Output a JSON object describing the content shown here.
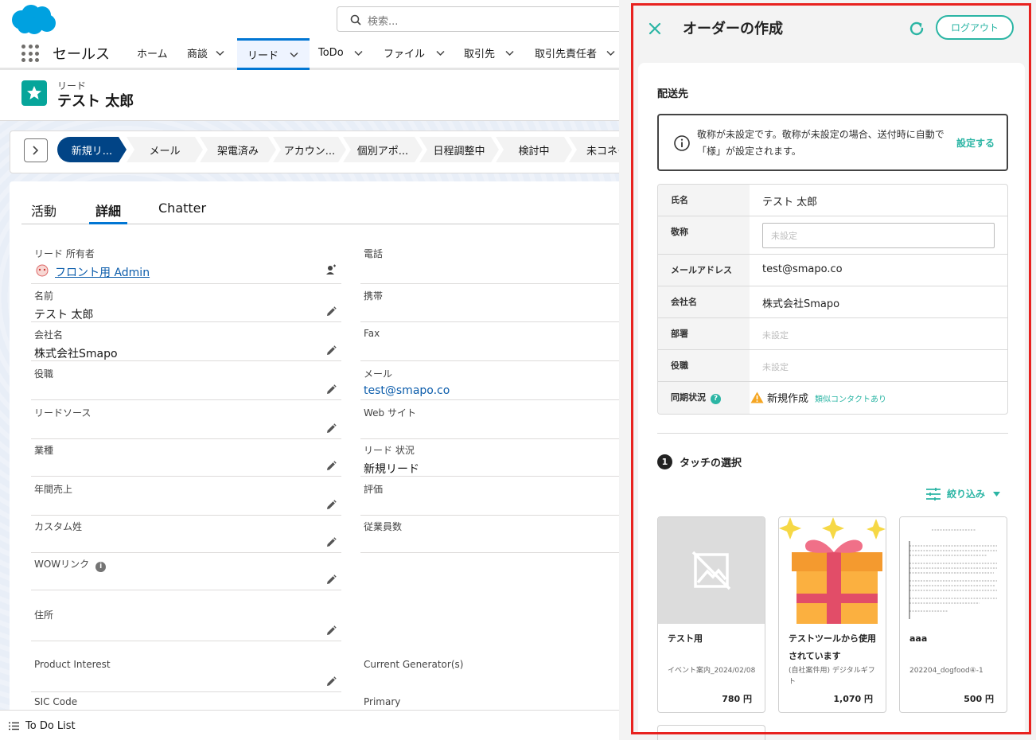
{
  "salesforce": {
    "search_placeholder": "検索...",
    "app_name": "セールス",
    "nav": [
      "ホーム",
      "商談",
      "リード",
      "ToDo",
      "ファイル",
      "取引先",
      "取引先責任者"
    ],
    "record": {
      "object_type": "リード",
      "name": "テスト 太郎"
    },
    "path_stages": [
      "新規リ...",
      "メール",
      "架電済み",
      "アカウン...",
      "個別アポ...",
      "日程調整中",
      "検討中",
      "未コネク"
    ],
    "tabs": [
      "活動",
      "詳細",
      "Chatter"
    ],
    "fields_left": [
      {
        "label": "リード 所有者",
        "value": "フロント用 Admin"
      },
      {
        "label": "名前",
        "value": "テスト 太郎"
      },
      {
        "label": "会社名",
        "value": "株式会社Smapo"
      },
      {
        "label": "役職",
        "value": ""
      },
      {
        "label": "リードソース",
        "value": ""
      },
      {
        "label": "業種",
        "value": ""
      },
      {
        "label": "年間売上",
        "value": ""
      },
      {
        "label": "カスタム姓",
        "value": ""
      },
      {
        "label": "WOWリンク",
        "value": ""
      },
      {
        "label": "住所",
        "value": ""
      },
      {
        "label": "Product Interest",
        "value": ""
      },
      {
        "label": "SIC Code",
        "value": ""
      }
    ],
    "fields_right": [
      {
        "label": "電話",
        "value": ""
      },
      {
        "label": "携帯",
        "value": ""
      },
      {
        "label": "Fax",
        "value": ""
      },
      {
        "label": "メール",
        "value": "test@smapo.co"
      },
      {
        "label": "Web サイト",
        "value": ""
      },
      {
        "label": "リード 状況",
        "value": "新規リード"
      },
      {
        "label": "評価",
        "value": ""
      },
      {
        "label": "従業員数",
        "value": ""
      },
      {
        "label": "Current Generator(s)",
        "value": ""
      },
      {
        "label": "Primary",
        "value": ""
      }
    ],
    "utility_label": "To Do List"
  },
  "panel": {
    "title": "オーダーの作成",
    "logout_label": "ログアウト",
    "section_title": "配送先",
    "alert_text": "敬称が未設定です。敬称が未設定の場合、送付時に自動で「様」が設定されます。",
    "alert_link": "設定する",
    "fields": {
      "name_label": "氏名",
      "name_value": "テスト 太郎",
      "honorific_label": "敬称",
      "honorific_placeholder": "未設定",
      "email_label": "メールアドレス",
      "email_value": "test@smapo.co",
      "company_label": "会社名",
      "company_value": "株式会社Smapo",
      "dept_label": "部署",
      "dept_value": "未設定",
      "title_label": "役職",
      "title_value": "未設定",
      "sync_label": "同期状況",
      "sync_help": "?",
      "sync_value": "新規作成",
      "sync_similar": "類似コンタクトあり"
    },
    "step_number": "1",
    "step_label": "タッチの選択",
    "filter_label": "絞り込み",
    "gifts": [
      {
        "name": "テスト用",
        "sub": "イベント案内_2024/02/08",
        "price": "780 円"
      },
      {
        "name": "テストツールから使用されています",
        "sub": "(自社案件用) デジタルギフト",
        "price": "1,070 円"
      },
      {
        "name": "aaa",
        "sub": "202204_dogfood④-1",
        "price": "500 円"
      }
    ]
  }
}
